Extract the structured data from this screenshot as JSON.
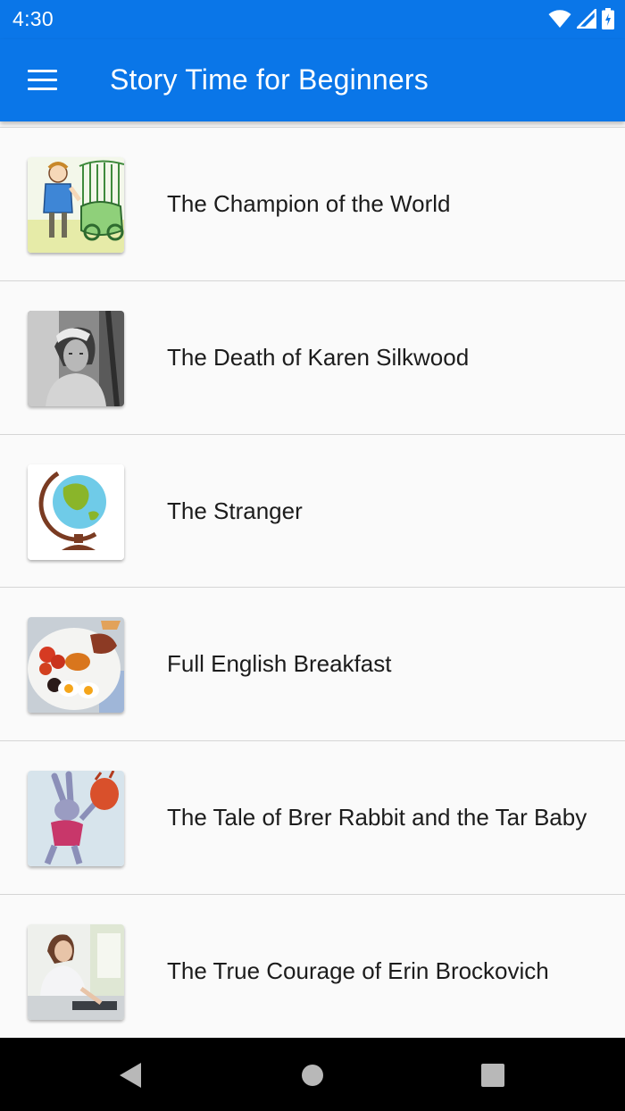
{
  "status_bar": {
    "time": "4:30",
    "icons": [
      "wifi-icon",
      "signal-icon",
      "battery-charging-icon"
    ]
  },
  "app_bar": {
    "menu_icon": "hamburger-menu-icon",
    "title": "Story Time for Beginners"
  },
  "stories": [
    {
      "title": "The Champion of the World",
      "thumbnail": "boy-with-car-illustration"
    },
    {
      "title": "The Death of Karen Silkwood",
      "thumbnail": "woman-bw-photo"
    },
    {
      "title": "The Stranger",
      "thumbnail": "globe-icon"
    },
    {
      "title": "Full English Breakfast",
      "thumbnail": "breakfast-plate-photo"
    },
    {
      "title": "The Tale of Brer Rabbit and the Tar Baby",
      "thumbnail": "rabbit-illustration"
    },
    {
      "title": "The True Courage of Erin Brockovich",
      "thumbnail": "woman-at-desk-photo"
    }
  ],
  "nav_bar": {
    "back": "back-triangle-icon",
    "home": "home-circle-icon",
    "recents": "recents-square-icon"
  },
  "colors": {
    "primary": "#0a76e8",
    "background": "#fafafa",
    "divider": "#d5d5d5",
    "text": "#1c1c1c"
  }
}
